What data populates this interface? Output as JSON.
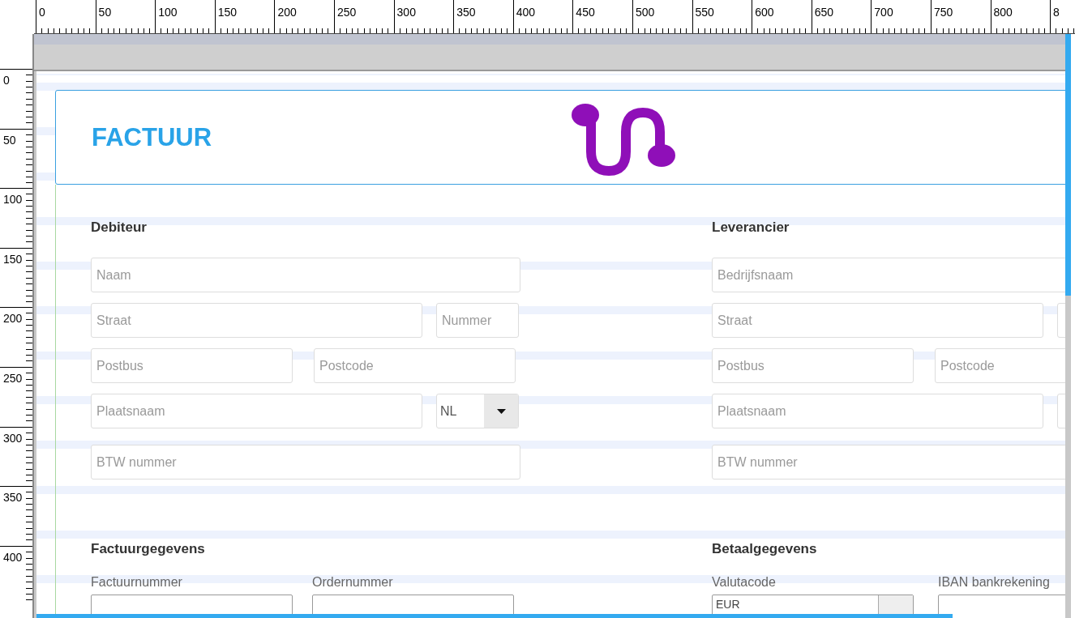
{
  "ruler": {
    "top_labels": [
      "0",
      "50",
      "100",
      "150",
      "200",
      "250",
      "300",
      "350",
      "400",
      "450",
      "500",
      "550",
      "600",
      "650",
      "700",
      "750",
      "800",
      "8"
    ],
    "left_labels": [
      "0",
      "50",
      "100",
      "150",
      "200",
      "250",
      "300",
      "350",
      "400"
    ]
  },
  "header": {
    "title": "FACTUUR"
  },
  "address_blocks": [
    {
      "title": "Debiteur",
      "rows": [
        [
          {
            "kind": "text",
            "placeholder": "Naam"
          }
        ],
        [
          {
            "kind": "text",
            "placeholder": "Straat"
          },
          {
            "kind": "text",
            "placeholder": "Nummer"
          }
        ],
        [
          {
            "kind": "text",
            "placeholder": "Postbus"
          },
          {
            "kind": "text",
            "placeholder": "Postcode"
          }
        ],
        [
          {
            "kind": "text",
            "placeholder": "Plaatsnaam"
          },
          {
            "kind": "select",
            "value": "NL"
          }
        ],
        [
          {
            "kind": "text",
            "placeholder": "BTW nummer"
          }
        ]
      ]
    },
    {
      "title": "Leverancier",
      "rows": [
        [
          {
            "kind": "text",
            "placeholder": "Bedrijfsnaam"
          }
        ],
        [
          {
            "kind": "text",
            "placeholder": "Straat"
          },
          {
            "kind": "text"
          }
        ],
        [
          {
            "kind": "text",
            "placeholder": "Postbus"
          },
          {
            "kind": "text",
            "placeholder": "Postcode"
          }
        ],
        [
          {
            "kind": "text",
            "placeholder": "Plaatsnaam"
          },
          {
            "kind": "text"
          }
        ],
        [
          {
            "kind": "text",
            "placeholder": "BTW nummer"
          }
        ]
      ]
    }
  ],
  "detail_blocks": [
    {
      "title": "Factuurgegevens",
      "fields": [
        {
          "label": "Factuurnummer",
          "kind": "text"
        },
        {
          "label": "Ordernummer",
          "kind": "text"
        }
      ]
    },
    {
      "title": "Betaalgegevens",
      "fields": [
        {
          "label": "Valutacode",
          "kind": "select",
          "value": "EUR"
        },
        {
          "label": "IBAN bankrekening",
          "kind": "text"
        }
      ]
    }
  ]
}
